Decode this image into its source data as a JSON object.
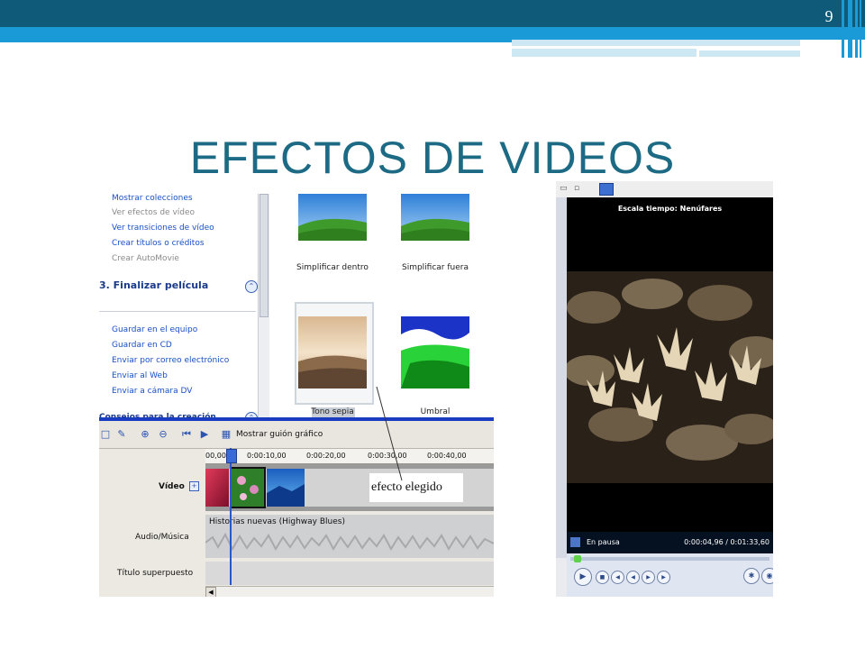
{
  "slide": {
    "number": "9",
    "title": "EFECTOS DE VIDEOS"
  },
  "colors": {
    "banner_dark": "#0e5a78",
    "banner_blue": "#1a9ad6",
    "title": "#1d6a85",
    "link": "#1a4fc4"
  },
  "tasks": {
    "edit_links": [
      {
        "label": "Mostrar colecciones",
        "enabled": true
      },
      {
        "label": "Ver efectos de vídeo",
        "enabled": false
      },
      {
        "label": "Ver transiciones de vídeo",
        "enabled": true
      },
      {
        "label": "Crear títulos o créditos",
        "enabled": true
      },
      {
        "label": "Crear AutoMovie",
        "enabled": false
      }
    ],
    "finalize_header": "3. Finalizar película",
    "finalize_links": [
      "Guardar en el equipo",
      "Guardar en CD",
      "Enviar por correo electrónico",
      "Enviar al Web",
      "Enviar a cámara DV"
    ],
    "next_header": "Consejos para la creación"
  },
  "effects": {
    "items": [
      {
        "label": "Simplificar dentro"
      },
      {
        "label": "Simplificar fuera"
      },
      {
        "label": "Tono sepia",
        "selected": true
      },
      {
        "label": "Umbral"
      }
    ]
  },
  "timeline": {
    "storyboard_button": "Mostrar guión gráfico",
    "ruler_ticks": [
      "00,00",
      "0:00:10,00",
      "0:00:20,00",
      "0:00:30,00",
      "0:00:40,00"
    ],
    "tracks": {
      "video": "Vídeo",
      "audio": "Audio/Música",
      "title": "Título superpuesto"
    },
    "audio_clip": "Historias nuevas (Highway Blues)",
    "annotation": "efecto elegido"
  },
  "player": {
    "title": "Escala tiempo: Nenúfares",
    "status": "En pausa",
    "time": "0:00:04,96 / 0:01:33,60"
  }
}
